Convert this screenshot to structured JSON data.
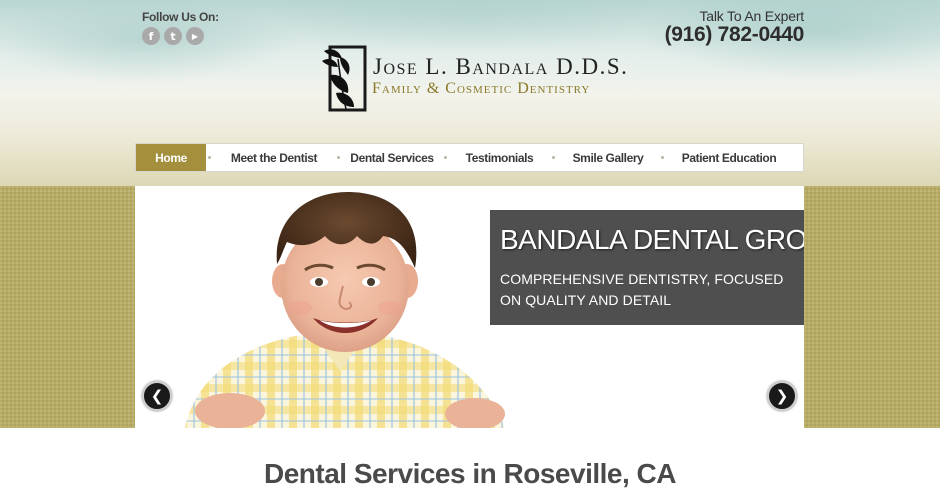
{
  "header": {
    "follow_label": "Follow Us On:",
    "social_icons": [
      {
        "name": "facebook-icon",
        "glyph": "f"
      },
      {
        "name": "twitter-icon",
        "glyph": "t"
      },
      {
        "name": "youtube-icon",
        "glyph": "▶"
      }
    ],
    "talk_label": "Talk To An Expert",
    "phone": "(916) 782-0440"
  },
  "logo": {
    "name": "Jose L. Bandala D.D.S.",
    "tagline": "Family & Cosmetic Dentistry"
  },
  "nav": {
    "items": [
      {
        "label": "Home",
        "active": true
      },
      {
        "label": "Meet the Dentist",
        "active": false
      },
      {
        "label": "Dental Services",
        "active": false
      },
      {
        "label": "Testimonials",
        "active": false
      },
      {
        "label": "Smile Gallery",
        "active": false
      },
      {
        "label": "Patient Education",
        "active": false
      }
    ]
  },
  "hero": {
    "title": "BANDALA DENTAL GROUP",
    "subtitle": "COMPREHENSIVE DENTISTRY, FOCUSED ON QUALITY AND DETAIL",
    "prev_glyph": "❮",
    "next_glyph": "❯"
  },
  "main": {
    "section_title": "Dental Services in Roseville, CA"
  },
  "colors": {
    "accent": "#a38f3c",
    "olive": "#b9ad62",
    "caption_bg": "#404040"
  }
}
